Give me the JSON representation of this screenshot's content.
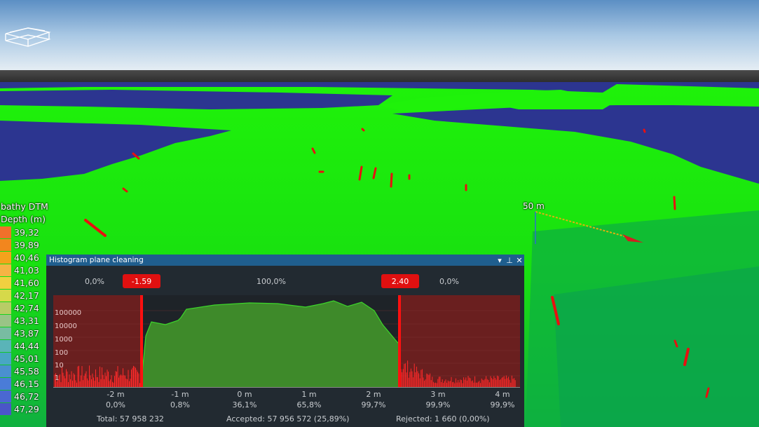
{
  "legend": {
    "title": "bathy DTM",
    "subtitle": "Depth (m)",
    "entries": [
      {
        "value": "39,32",
        "color": "#f0702a"
      },
      {
        "value": "39,89",
        "color": "#f2861e"
      },
      {
        "value": "40,46",
        "color": "#f5a21c"
      },
      {
        "value": "41,03",
        "color": "#f6b444"
      },
      {
        "value": "41,60",
        "color": "#f0d040"
      },
      {
        "value": "42,17",
        "color": "#d6d94a"
      },
      {
        "value": "42,74",
        "color": "#b8cc66"
      },
      {
        "value": "43,31",
        "color": "#99c486"
      },
      {
        "value": "43,87",
        "color": "#78bca2"
      },
      {
        "value": "44,44",
        "color": "#5ab4b8"
      },
      {
        "value": "45,01",
        "color": "#48a6c4"
      },
      {
        "value": "45,58",
        "color": "#4a90d0"
      },
      {
        "value": "46,15",
        "color": "#4a7cd8"
      },
      {
        "value": "46,72",
        "color": "#4a68d2"
      },
      {
        "value": "47,29",
        "color": "#4a56c8"
      }
    ]
  },
  "scale_label": "50 m",
  "panel": {
    "title": "Histogram plane cleaning",
    "left_pct": "0,0%",
    "center_pct": "100,0%",
    "right_pct": "0,0%",
    "low_threshold": "-1.59",
    "high_threshold": "2.40",
    "x_ticks": [
      {
        "label": "-2 m",
        "cum": "0,0%"
      },
      {
        "label": "-1 m",
        "cum": "0,8%"
      },
      {
        "label": "0 m",
        "cum": "36,1%"
      },
      {
        "label": "1 m",
        "cum": "65,8%"
      },
      {
        "label": "2 m",
        "cum": "99,7%"
      },
      {
        "label": "3 m",
        "cum": "99,9%"
      },
      {
        "label": "4 m",
        "cum": "99,9%"
      }
    ],
    "y_labels": [
      "100000",
      "10000",
      "1000",
      "100",
      "10",
      "1"
    ],
    "total": "Total: 57 958 232",
    "accepted": "Accepted: 57 956 572 (25,89%)",
    "rejected": "Rejected: 1 660 (0,00%)"
  },
  "colors": {
    "sky_top": "#5c8fc4",
    "water": "#2c3590",
    "terrain": "#1ff20a",
    "deep_terrain": "#0aa848",
    "spike": "#e81010",
    "titlebar": "#1f5e8e",
    "panel_bg": "#222a31",
    "accept_fill": "#3e8a2a",
    "reject_fill": "#6a1f1f"
  }
}
